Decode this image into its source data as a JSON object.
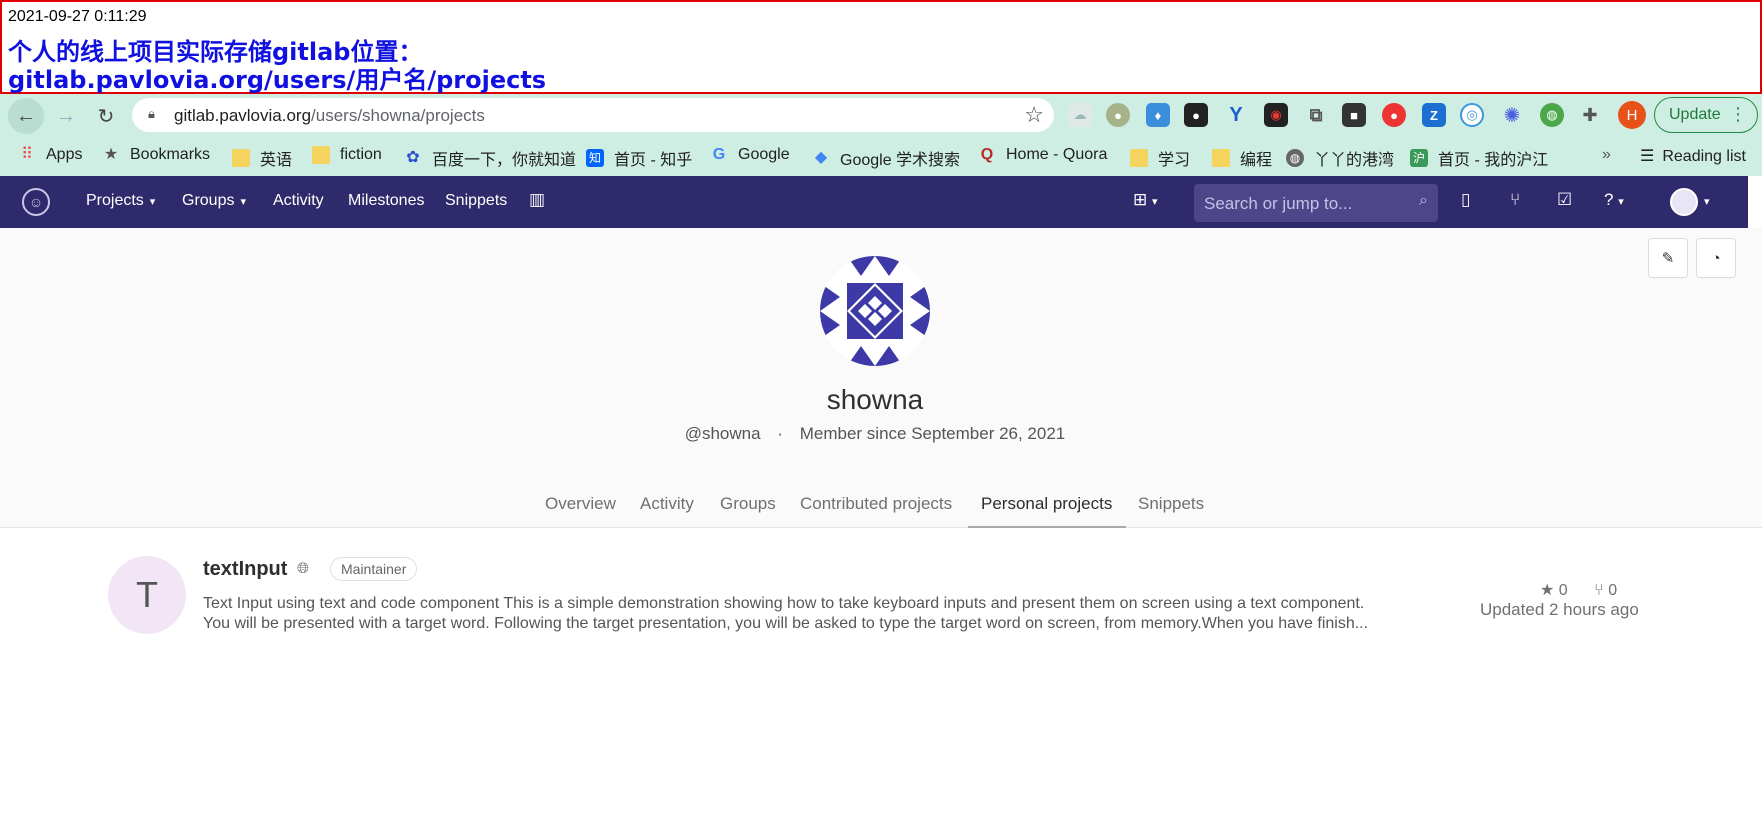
{
  "annotation": {
    "timestamp": "2021-09-27 0:11:29",
    "line1": "个人的线上项目实际存储gitlab位置：",
    "line2": "gitlab.pavlovia.org/users/用户名/projects"
  },
  "browser": {
    "url_host": "gitlab.pavlovia.org",
    "url_path": "/users/showna/projects",
    "update_label": "Update",
    "profile_initial": "H",
    "bookmarks": [
      {
        "label": "Apps",
        "icon": "apps-grid-icon"
      },
      {
        "label": "Bookmarks",
        "icon": "star-icon"
      },
      {
        "label": "英语",
        "icon": "folder-icon"
      },
      {
        "label": "fiction",
        "icon": "folder-icon"
      },
      {
        "label": "百度一下，你就知道",
        "icon": "baidu-icon"
      },
      {
        "label": "首页 - 知乎",
        "icon": "zhihu-icon"
      },
      {
        "label": "Google",
        "icon": "google-icon"
      },
      {
        "label": "Google 学术搜索",
        "icon": "scholar-icon"
      },
      {
        "label": "Home - Quora",
        "icon": "quora-icon"
      },
      {
        "label": "学习",
        "icon": "folder-icon"
      },
      {
        "label": "编程",
        "icon": "folder-icon"
      },
      {
        "label": "丫丫的港湾",
        "icon": "globe-icon"
      },
      {
        "label": "首页 - 我的沪江",
        "icon": "hujiang-icon"
      }
    ],
    "more": "»",
    "reading_list": "Reading list"
  },
  "gitlab": {
    "nav": {
      "projects": "Projects",
      "groups": "Groups",
      "activity": "Activity",
      "milestones": "Milestones",
      "snippets": "Snippets"
    },
    "search_placeholder": "Search or jump to..."
  },
  "profile": {
    "name": "showna",
    "handle": "@showna",
    "separator": "·",
    "member_since": "Member since September 26, 2021",
    "tabs": [
      "Overview",
      "Activity",
      "Groups",
      "Contributed projects",
      "Personal projects",
      "Snippets"
    ],
    "active_tab": "Personal projects"
  },
  "projects": [
    {
      "initial": "T",
      "name": "textInput",
      "role": "Maintainer",
      "description_line1": "Text Input using text and code component This is a simple demonstration showing how to take keyboard inputs and present them on screen using a text component.",
      "description_line2": "You will be presented with a target word. Following the target presentation, you will be asked to type the target word on screen, from memory.When you have finish...",
      "stars": "0",
      "forks": "0",
      "updated": "Updated 2 hours ago"
    }
  ],
  "colors": {
    "header": "#2f2a6b",
    "chrome": "#cfeee3",
    "banner_border": "#e00000",
    "banner_text": "#1010e0"
  }
}
